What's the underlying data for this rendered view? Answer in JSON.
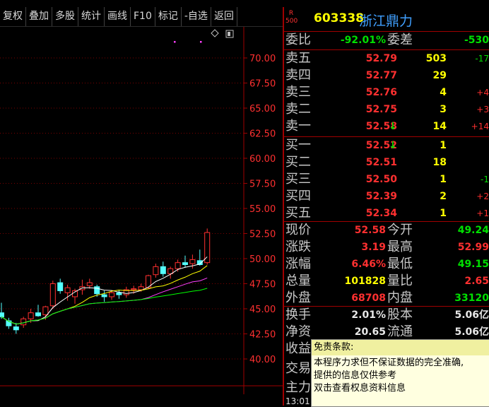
{
  "toolbar": [
    {
      "key": "fuquan",
      "label": "复权"
    },
    {
      "key": "diejia",
      "label": "叠加"
    },
    {
      "key": "duogu",
      "label": "多股"
    },
    {
      "key": "tongji",
      "label": "统计"
    },
    {
      "key": "huaxian",
      "label": "画线"
    },
    {
      "key": "f10",
      "label": "F10"
    },
    {
      "key": "biaoji",
      "label": "标记"
    },
    {
      "key": "zixuan",
      "label": "-自选"
    },
    {
      "key": "fanhui",
      "label": "返回"
    }
  ],
  "chart_data": {
    "type": "candlestick",
    "price_ticks": [
      "70.00",
      "67.50",
      "65.00",
      "62.50",
      "60.00",
      "57.50",
      "55.00",
      "52.50",
      "50.00",
      "47.50",
      "45.00",
      "42.50",
      "40.00"
    ],
    "ylim": [
      40.0,
      70.0
    ],
    "candles": [
      {
        "o": 44.6,
        "h": 45.6,
        "l": 44.0,
        "c": 44.2
      },
      {
        "o": 43.8,
        "h": 44.1,
        "l": 43.0,
        "c": 43.3
      },
      {
        "o": 43.2,
        "h": 43.6,
        "l": 42.5,
        "c": 42.9
      },
      {
        "o": 43.4,
        "h": 44.2,
        "l": 43.1,
        "c": 44.0
      },
      {
        "o": 44.0,
        "h": 45.0,
        "l": 43.6,
        "c": 44.6
      },
      {
        "o": 44.6,
        "h": 45.4,
        "l": 44.2,
        "c": 44.3
      },
      {
        "o": 44.4,
        "h": 45.3,
        "l": 43.9,
        "c": 45.2
      },
      {
        "o": 45.3,
        "h": 47.8,
        "l": 45.0,
        "c": 47.5
      },
      {
        "o": 47.6,
        "h": 48.0,
        "l": 46.5,
        "c": 46.8
      },
      {
        "o": 46.6,
        "h": 47.4,
        "l": 45.8,
        "c": 47.1
      },
      {
        "o": 46.2,
        "h": 47.0,
        "l": 45.5,
        "c": 46.8
      },
      {
        "o": 46.9,
        "h": 47.9,
        "l": 46.4,
        "c": 47.2
      },
      {
        "o": 47.3,
        "h": 48.0,
        "l": 47.0,
        "c": 47.6
      },
      {
        "o": 47.2,
        "h": 47.4,
        "l": 46.2,
        "c": 46.5
      },
      {
        "o": 46.4,
        "h": 46.8,
        "l": 45.7,
        "c": 46.2
      },
      {
        "o": 46.2,
        "h": 46.8,
        "l": 45.9,
        "c": 46.6
      },
      {
        "o": 46.6,
        "h": 46.9,
        "l": 46.0,
        "c": 46.4
      },
      {
        "o": 46.4,
        "h": 47.2,
        "l": 46.1,
        "c": 46.9
      },
      {
        "o": 46.9,
        "h": 47.3,
        "l": 46.5,
        "c": 47.0
      },
      {
        "o": 46.9,
        "h": 47.5,
        "l": 46.7,
        "c": 47.2
      },
      {
        "o": 47.1,
        "h": 48.4,
        "l": 47.0,
        "c": 48.3
      },
      {
        "o": 48.4,
        "h": 49.5,
        "l": 48.1,
        "c": 49.2
      },
      {
        "o": 49.2,
        "h": 49.7,
        "l": 48.2,
        "c": 48.5
      },
      {
        "o": 48.5,
        "h": 49.2,
        "l": 48.0,
        "c": 49.0
      },
      {
        "o": 49.0,
        "h": 49.9,
        "l": 48.7,
        "c": 49.6
      },
      {
        "o": 49.6,
        "h": 50.3,
        "l": 49.1,
        "c": 49.4
      },
      {
        "o": 49.5,
        "h": 50.4,
        "l": 49.0,
        "c": 49.9
      },
      {
        "o": 49.8,
        "h": 50.9,
        "l": 49.3,
        "c": 49.4
      },
      {
        "o": 49.6,
        "h": 53.0,
        "l": 49.4,
        "c": 52.6
      }
    ]
  },
  "header": {
    "r_badge_top": "R",
    "r_badge_bot": "500",
    "code": "603338",
    "name": "浙江鼎力"
  },
  "weibi": {
    "label": "委比",
    "value": "-92.01%",
    "label2": "委差",
    "value2": "-530"
  },
  "sells": [
    {
      "label": "卖五",
      "price": "52.79",
      "vol": "503",
      "chg": "-17",
      "arrow": ""
    },
    {
      "label": "卖四",
      "price": "52.77",
      "vol": "29",
      "chg": "",
      "arrow": ""
    },
    {
      "label": "卖三",
      "price": "52.76",
      "vol": "4",
      "chg": "+4",
      "arrow": ""
    },
    {
      "label": "卖二",
      "price": "52.75",
      "vol": "3",
      "chg": "+3",
      "arrow": ""
    },
    {
      "label": "卖一",
      "price": "52.58",
      "vol": "14",
      "chg": "+14",
      "arrow": "↓"
    }
  ],
  "buys": [
    {
      "label": "买一",
      "price": "52.52",
      "vol": "1",
      "chg": "",
      "arrow": "↓"
    },
    {
      "label": "买二",
      "price": "52.51",
      "vol": "18",
      "chg": "",
      "arrow": ""
    },
    {
      "label": "买三",
      "price": "52.50",
      "vol": "1",
      "chg": "-1",
      "arrow": ""
    },
    {
      "label": "买四",
      "price": "52.39",
      "vol": "2",
      "chg": "+2",
      "arrow": ""
    },
    {
      "label": "买五",
      "price": "52.34",
      "vol": "1",
      "chg": "+1",
      "arrow": ""
    }
  ],
  "stats": [
    {
      "l1": "现价",
      "v1": "52.58",
      "c1": "red",
      "l2": "今开",
      "v2": "49.24",
      "c2": "grn"
    },
    {
      "l1": "涨跌",
      "v1": "3.19",
      "c1": "red",
      "l2": "最高",
      "v2": "52.99",
      "c2": "red"
    },
    {
      "l1": "涨幅",
      "v1": "6.46%",
      "c1": "red",
      "l2": "最低",
      "v2": "49.15",
      "c2": "grn"
    },
    {
      "l1": "总量",
      "v1": "101828",
      "c1": "yel",
      "l2": "量比",
      "v2": "2.65",
      "c2": "red"
    },
    {
      "l1": "外盘",
      "v1": "68708",
      "c1": "red",
      "l2": "内盘",
      "v2": "33120",
      "c2": "grn"
    }
  ],
  "stats2": [
    {
      "l1": "换手",
      "v1": "2.01%",
      "l2": "股本",
      "v2": "5.06亿"
    },
    {
      "l1": "净资",
      "v1": "20.65",
      "l2": "流通",
      "v2": "5.06亿"
    },
    {
      "l1": "收益",
      "v1": "",
      "l2": "",
      "v2": ""
    }
  ],
  "extra_labels": {
    "jiaoyi": "交易",
    "zhuli": "主力",
    "time": "13:01"
  },
  "tooltip": {
    "title": "免责条款:",
    "line1": "本程序力求但不保证数据的完全准确,",
    "line2": "提供的信息仅供参考",
    "line3": "双击查看权息资料信息"
  }
}
